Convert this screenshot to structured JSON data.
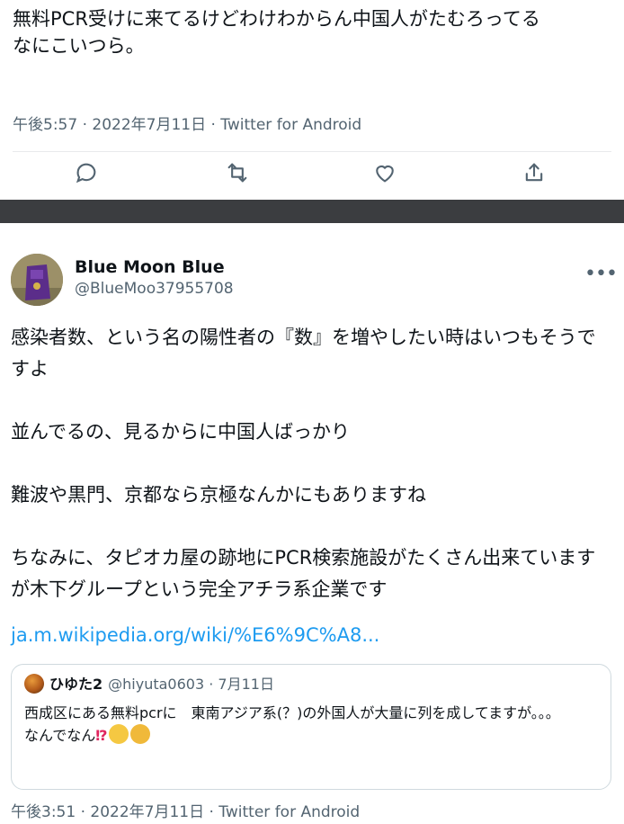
{
  "tweet1": {
    "text": "無料PCR受けに来てるけどわけわからん中国人がたむろってる\nなにこいつら。",
    "meta": "午後5:57 · 2022年7月11日 · Twitter for Android"
  },
  "actions": [
    "reply-icon",
    "retweet-icon",
    "like-icon",
    "share-icon"
  ],
  "tweet2": {
    "display_name": "Blue Moon Blue",
    "handle": "@BlueMoo37955708",
    "more": "•••",
    "paragraphs": [
      "感染者数、という名の陽性者の『数』を増やしたい時はいつもそうですよ",
      "並んでるの、見るからに中国人ばっかり",
      "難波や黒門、京都なら京極なんかにもありますね",
      "ちなみに、タピオカ屋の跡地にPCR検索施設がたくさん出来ていますが木下グループという完全アチラ系企業です"
    ],
    "link": "ja.m.wikipedia.org/wiki/%E6%9C%A8...",
    "quote": {
      "name": "ひゆた2",
      "handle": "@hiyuta0603",
      "date": "· 7月11日",
      "line1": "西成区にある無料pcrに　東南アジア系(？)の外国人が大量に列を成してますが。。。",
      "line2": "なんでなん",
      "line2_marks": "⁉"
    },
    "meta": "午後3:51 · 2022年7月11日 · Twitter for Android"
  },
  "colors": {
    "link": "#1d9bf0",
    "secondary": "#536471",
    "band": "#3b3d40"
  }
}
